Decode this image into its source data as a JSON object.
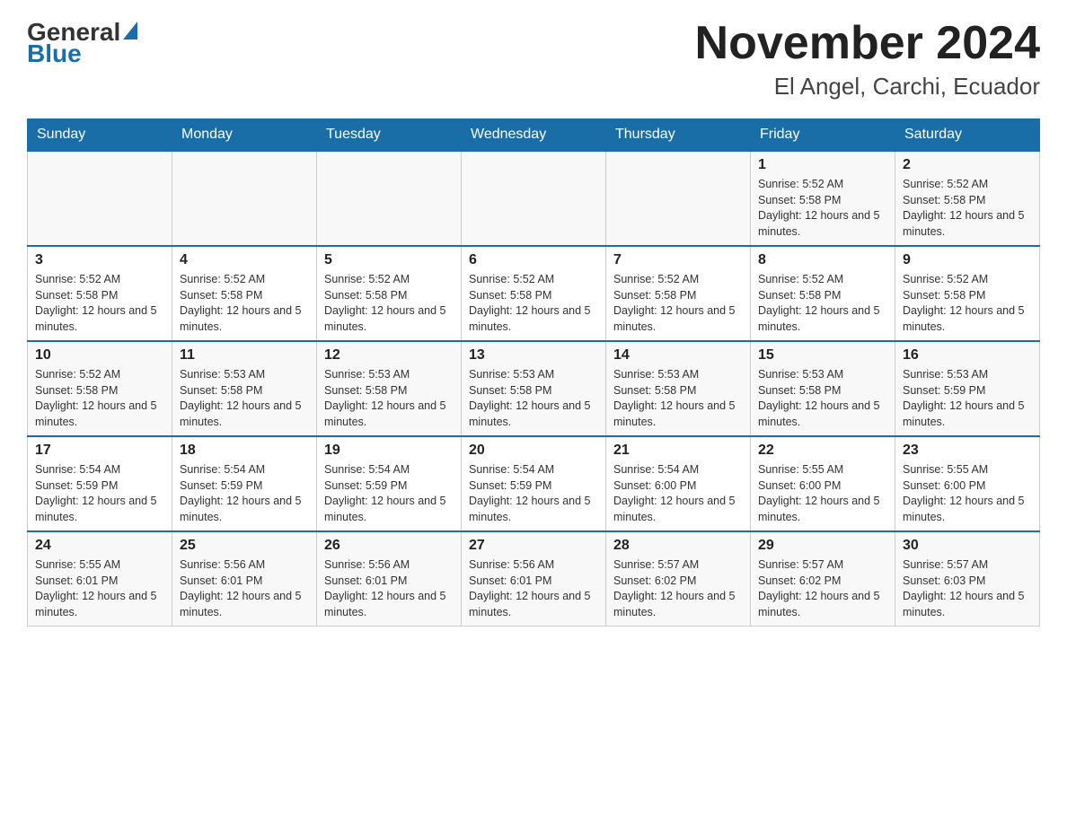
{
  "logo": {
    "general": "General",
    "blue": "Blue"
  },
  "header": {
    "month_title": "November 2024",
    "location": "El Angel, Carchi, Ecuador"
  },
  "weekdays": [
    "Sunday",
    "Monday",
    "Tuesday",
    "Wednesday",
    "Thursday",
    "Friday",
    "Saturday"
  ],
  "weeks": [
    [
      {
        "day": "",
        "info": ""
      },
      {
        "day": "",
        "info": ""
      },
      {
        "day": "",
        "info": ""
      },
      {
        "day": "",
        "info": ""
      },
      {
        "day": "",
        "info": ""
      },
      {
        "day": "1",
        "info": "Sunrise: 5:52 AM\nSunset: 5:58 PM\nDaylight: 12 hours and 5 minutes."
      },
      {
        "day": "2",
        "info": "Sunrise: 5:52 AM\nSunset: 5:58 PM\nDaylight: 12 hours and 5 minutes."
      }
    ],
    [
      {
        "day": "3",
        "info": "Sunrise: 5:52 AM\nSunset: 5:58 PM\nDaylight: 12 hours and 5 minutes."
      },
      {
        "day": "4",
        "info": "Sunrise: 5:52 AM\nSunset: 5:58 PM\nDaylight: 12 hours and 5 minutes."
      },
      {
        "day": "5",
        "info": "Sunrise: 5:52 AM\nSunset: 5:58 PM\nDaylight: 12 hours and 5 minutes."
      },
      {
        "day": "6",
        "info": "Sunrise: 5:52 AM\nSunset: 5:58 PM\nDaylight: 12 hours and 5 minutes."
      },
      {
        "day": "7",
        "info": "Sunrise: 5:52 AM\nSunset: 5:58 PM\nDaylight: 12 hours and 5 minutes."
      },
      {
        "day": "8",
        "info": "Sunrise: 5:52 AM\nSunset: 5:58 PM\nDaylight: 12 hours and 5 minutes."
      },
      {
        "day": "9",
        "info": "Sunrise: 5:52 AM\nSunset: 5:58 PM\nDaylight: 12 hours and 5 minutes."
      }
    ],
    [
      {
        "day": "10",
        "info": "Sunrise: 5:52 AM\nSunset: 5:58 PM\nDaylight: 12 hours and 5 minutes."
      },
      {
        "day": "11",
        "info": "Sunrise: 5:53 AM\nSunset: 5:58 PM\nDaylight: 12 hours and 5 minutes."
      },
      {
        "day": "12",
        "info": "Sunrise: 5:53 AM\nSunset: 5:58 PM\nDaylight: 12 hours and 5 minutes."
      },
      {
        "day": "13",
        "info": "Sunrise: 5:53 AM\nSunset: 5:58 PM\nDaylight: 12 hours and 5 minutes."
      },
      {
        "day": "14",
        "info": "Sunrise: 5:53 AM\nSunset: 5:58 PM\nDaylight: 12 hours and 5 minutes."
      },
      {
        "day": "15",
        "info": "Sunrise: 5:53 AM\nSunset: 5:58 PM\nDaylight: 12 hours and 5 minutes."
      },
      {
        "day": "16",
        "info": "Sunrise: 5:53 AM\nSunset: 5:59 PM\nDaylight: 12 hours and 5 minutes."
      }
    ],
    [
      {
        "day": "17",
        "info": "Sunrise: 5:54 AM\nSunset: 5:59 PM\nDaylight: 12 hours and 5 minutes."
      },
      {
        "day": "18",
        "info": "Sunrise: 5:54 AM\nSunset: 5:59 PM\nDaylight: 12 hours and 5 minutes."
      },
      {
        "day": "19",
        "info": "Sunrise: 5:54 AM\nSunset: 5:59 PM\nDaylight: 12 hours and 5 minutes."
      },
      {
        "day": "20",
        "info": "Sunrise: 5:54 AM\nSunset: 5:59 PM\nDaylight: 12 hours and 5 minutes."
      },
      {
        "day": "21",
        "info": "Sunrise: 5:54 AM\nSunset: 6:00 PM\nDaylight: 12 hours and 5 minutes."
      },
      {
        "day": "22",
        "info": "Sunrise: 5:55 AM\nSunset: 6:00 PM\nDaylight: 12 hours and 5 minutes."
      },
      {
        "day": "23",
        "info": "Sunrise: 5:55 AM\nSunset: 6:00 PM\nDaylight: 12 hours and 5 minutes."
      }
    ],
    [
      {
        "day": "24",
        "info": "Sunrise: 5:55 AM\nSunset: 6:01 PM\nDaylight: 12 hours and 5 minutes."
      },
      {
        "day": "25",
        "info": "Sunrise: 5:56 AM\nSunset: 6:01 PM\nDaylight: 12 hours and 5 minutes."
      },
      {
        "day": "26",
        "info": "Sunrise: 5:56 AM\nSunset: 6:01 PM\nDaylight: 12 hours and 5 minutes."
      },
      {
        "day": "27",
        "info": "Sunrise: 5:56 AM\nSunset: 6:01 PM\nDaylight: 12 hours and 5 minutes."
      },
      {
        "day": "28",
        "info": "Sunrise: 5:57 AM\nSunset: 6:02 PM\nDaylight: 12 hours and 5 minutes."
      },
      {
        "day": "29",
        "info": "Sunrise: 5:57 AM\nSunset: 6:02 PM\nDaylight: 12 hours and 5 minutes."
      },
      {
        "day": "30",
        "info": "Sunrise: 5:57 AM\nSunset: 6:03 PM\nDaylight: 12 hours and 5 minutes."
      }
    ]
  ]
}
